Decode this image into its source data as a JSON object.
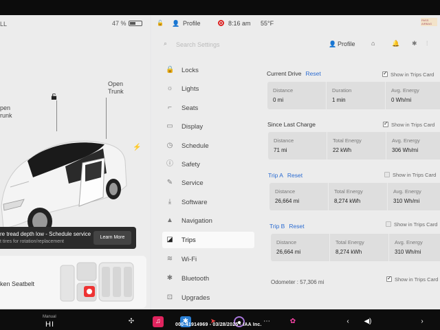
{
  "left_status": {
    "signal": "LL",
    "battery": "47 %"
  },
  "car": {
    "open_trunk_right": [
      "Open",
      "Trunk"
    ],
    "open_trunk_left": [
      "pen",
      "runk"
    ]
  },
  "alert": {
    "message": "re tread depth low - Schedule service",
    "sub": "t tires for rotation/replacement",
    "button": "Learn More"
  },
  "seatbelt": {
    "label": "ken Seatbelt"
  },
  "topbar": {
    "profile": "Profile",
    "time": "8:16 am",
    "temp": "55°F",
    "badge": "PASS AIRBAG"
  },
  "search": {
    "placeholder": "Search Settings",
    "profile": "Profile"
  },
  "nav": [
    {
      "label": "Locks",
      "icon": "🔒"
    },
    {
      "label": "Lights",
      "icon": "☼"
    },
    {
      "label": "Seats",
      "icon": "⌐"
    },
    {
      "label": "Display",
      "icon": "▭"
    },
    {
      "label": "Schedule",
      "icon": "◷"
    },
    {
      "label": "Safety",
      "icon": "ⓘ"
    },
    {
      "label": "Service",
      "icon": "✎"
    },
    {
      "label": "Software",
      "icon": "⤓"
    },
    {
      "label": "Navigation",
      "icon": "▲"
    },
    {
      "label": "Trips",
      "icon": "◪"
    },
    {
      "label": "Wi-Fi",
      "icon": "≋"
    },
    {
      "label": "Bluetooth",
      "icon": "✱"
    },
    {
      "label": "Upgrades",
      "icon": "⊡"
    }
  ],
  "trips": {
    "current_drive": {
      "title": "Current Drive",
      "reset": "Reset",
      "show": "Show in Trips Card",
      "checked": true,
      "stats": [
        {
          "k": "Distance",
          "v": "0 mi"
        },
        {
          "k": "Duration",
          "v": "1 min"
        },
        {
          "k": "Avg. Energy",
          "v": "0 Wh/mi"
        }
      ]
    },
    "since_charge": {
      "title": "Since Last Charge",
      "show": "Show in Trips Card",
      "checked": true,
      "stats": [
        {
          "k": "Distance",
          "v": "71 mi"
        },
        {
          "k": "Total Energy",
          "v": "22 kWh"
        },
        {
          "k": "Avg. Energy",
          "v": "306 Wh/mi"
        }
      ]
    },
    "trip_a": {
      "title": "Trip A",
      "reset": "Reset",
      "show": "Show in Trips Card",
      "checked": false,
      "stats": [
        {
          "k": "Distance",
          "v": "26,664 mi"
        },
        {
          "k": "Total Energy",
          "v": "8,274 kWh"
        },
        {
          "k": "Avg. Energy",
          "v": "310 Wh/mi"
        }
      ]
    },
    "trip_b": {
      "title": "Trip B",
      "reset": "Reset",
      "show": "Show in Trips Card",
      "checked": false,
      "stats": [
        {
          "k": "Distance",
          "v": "26,664 mi"
        },
        {
          "k": "Total Energy",
          "v": "8,274 kWh"
        },
        {
          "k": "Avg. Energy",
          "v": "310 Wh/mi"
        }
      ]
    },
    "odometer": "Odometer :  57,306 mi",
    "odometer_show": "Show in Trips Card"
  },
  "taskbar": {
    "manual": "Manual",
    "gear": "HI"
  },
  "watermark": "000-41914969 - 03/28/2025 - IAA Inc."
}
